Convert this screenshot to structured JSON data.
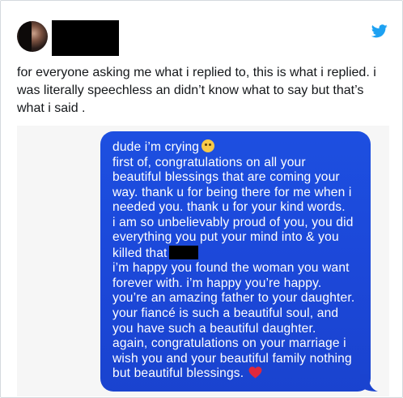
{
  "tweet": {
    "text_lines": [
      "for everyone asking me what i replied to, this is what i replied. i",
      "was literally speechless an didn’t know what to say but that’s",
      "what i said ."
    ],
    "icons": {
      "avatar": "profile-avatar",
      "brand": "twitter-bird-icon",
      "brand_color": "#1da1f2"
    }
  },
  "message": {
    "bubble_color": "#1c48d9",
    "text_color": "#ffffff",
    "lines": [
      "dude i’m crying",
      "first of, congratulations on all your",
      "beautiful blessings that are coming your",
      "way. thank u for being there for me when i",
      "needed you. thank u for your kind words.",
      "i am so unbelievably proud of you, you did",
      "everything you put your mind into & you",
      "killed that",
      "i’m happy you found the woman you want",
      "forever with. i’m happy you’re happy.",
      "you’re an amazing father to your daughter.",
      "your fiancé is such a beautiful soul, and",
      "you have such a beautiful daughter.",
      "again, congratulations on your marriage i",
      "wish you and your beautiful family nothing",
      "but beautiful blessings."
    ],
    "emoji": {
      "crying": "crying-face-emoji",
      "heart": "red-heart-emoji"
    }
  }
}
